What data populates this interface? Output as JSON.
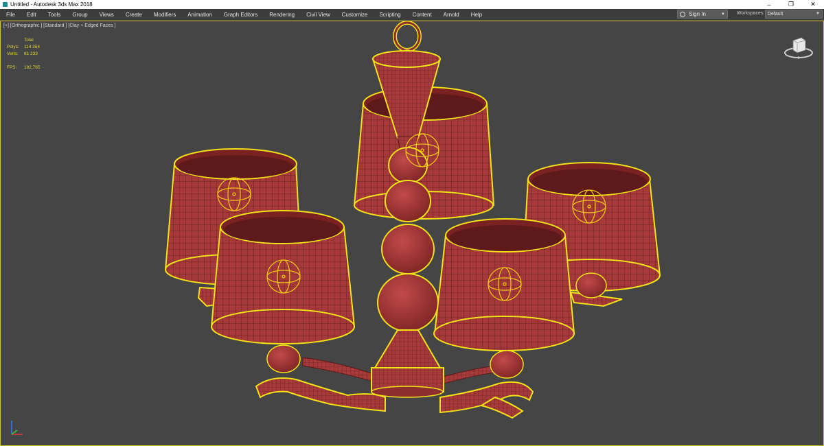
{
  "window": {
    "title": "Untitled - Autodesk 3ds Max 2018",
    "controls": {
      "minimize": "–",
      "restore": "❐",
      "close": "✕"
    }
  },
  "menu": {
    "items": [
      {
        "label": "File"
      },
      {
        "label": "Edit"
      },
      {
        "label": "Tools"
      },
      {
        "label": "Group"
      },
      {
        "label": "Views"
      },
      {
        "label": "Create"
      },
      {
        "label": "Modifiers"
      },
      {
        "label": "Animation"
      },
      {
        "label": "Graph Editors"
      },
      {
        "label": "Rendering"
      },
      {
        "label": "Civil View"
      },
      {
        "label": "Customize"
      },
      {
        "label": "Scripting"
      },
      {
        "label": "Content"
      },
      {
        "label": "Arnold"
      },
      {
        "label": "Help"
      }
    ],
    "signin_label": "Sign In",
    "workspaces_label": "Workspaces:",
    "workspaces_value": "Default"
  },
  "viewport": {
    "label": "[+] [Orthographic ] [Standard ] [Clay + Edged Faces ]",
    "stats": {
      "header": "Total",
      "polys_label": "Polys:",
      "polys_value": "114 354",
      "verts_label": "Verts:",
      "verts_value": "61 233",
      "fps_label": "FPS:",
      "fps_value": "182,765"
    },
    "colors": {
      "background": "#454545",
      "selection": "#f2e21a",
      "model": "#a63a3a",
      "wire": "#5e1d1d",
      "stats_text": "#e3d640"
    },
    "icons": [
      "viewcube-icon",
      "axis-tripod-icon",
      "gizmo-icon"
    ]
  }
}
